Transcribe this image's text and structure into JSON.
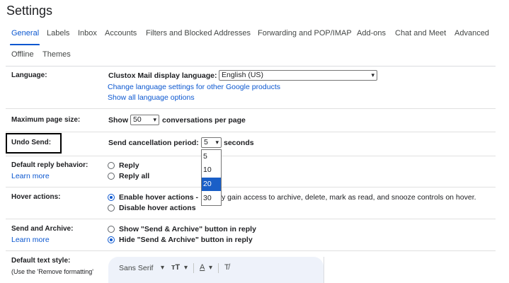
{
  "page_title": "Settings",
  "tabs": [
    {
      "label": "General"
    },
    {
      "label": "Labels"
    },
    {
      "label": "Inbox"
    },
    {
      "label": "Accounts"
    },
    {
      "label": "Filters and Blocked Addresses"
    },
    {
      "label": "Forwarding and POP/IMAP"
    },
    {
      "label": "Add-ons"
    },
    {
      "label": "Chat and Meet"
    },
    {
      "label": "Advanced"
    },
    {
      "label": "Offline"
    },
    {
      "label": "Themes"
    }
  ],
  "language": {
    "label": "Language:",
    "display_label": "Clustox Mail display language:",
    "selected": "English (US)",
    "change_link": "Change language settings for other Google products",
    "show_all_link": "Show all language options"
  },
  "page_size": {
    "label": "Maximum page size:",
    "prefix": "Show",
    "selected": "50",
    "suffix": "conversations per page"
  },
  "undo_send": {
    "label": "Undo Send:",
    "period_label": "Send cancellation period:",
    "selected": "5",
    "suffix": "seconds",
    "options": [
      "5",
      "10",
      "20",
      "30"
    ],
    "highlighted": "20"
  },
  "reply": {
    "label": "Default reply behavior:",
    "learn_more": "Learn more",
    "options": [
      "Reply",
      "Reply all"
    ]
  },
  "hover": {
    "label": "Hover actions:",
    "enable": "Enable hover actions -",
    "enable_desc": "y gain access to archive, delete, mark as read, and snooze controls on hover.",
    "disable": "Disable hover actions"
  },
  "send_archive": {
    "label": "Send and Archive:",
    "learn_more": "Learn more",
    "show": "Show \"Send & Archive\" button in reply",
    "hide": "Hide \"Send & Archive\" button in reply"
  },
  "text_style": {
    "label": "Default text style:",
    "sublabel": "(Use the 'Remove formatting'",
    "font": "Sans Serif"
  },
  "icons": {
    "chevron": "▾",
    "text_size": "ᴛT",
    "text_color": "A",
    "remove_format": "T̸"
  },
  "colors": {
    "accent": "#0b57d0",
    "highlight": "#1a5fc7"
  }
}
